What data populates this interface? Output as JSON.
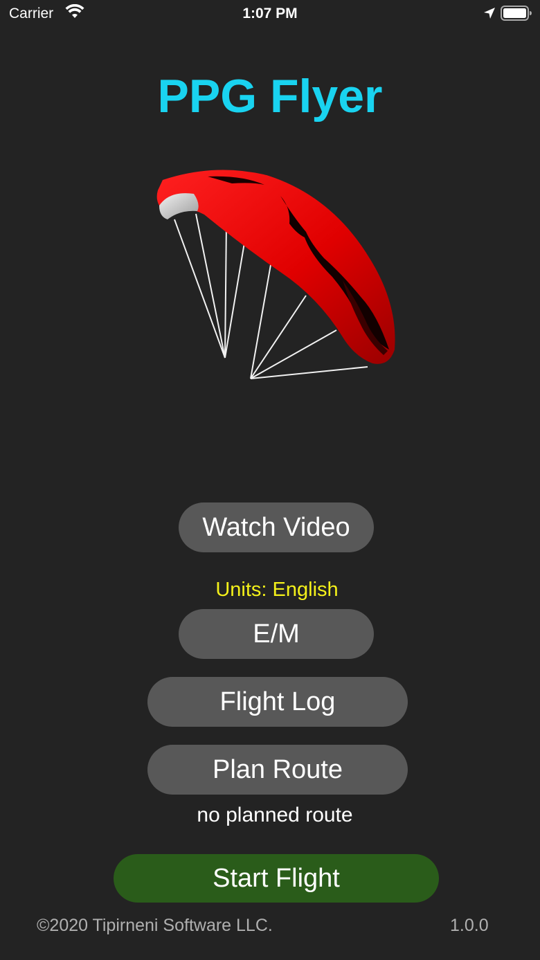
{
  "status_bar": {
    "carrier": "Carrier",
    "time": "1:07 PM",
    "icons": [
      "wifi-icon",
      "location-arrow-icon",
      "battery-icon"
    ]
  },
  "app": {
    "title": "PPG Flyer",
    "title_color": "#19d3f0",
    "logo_icon": "paraglider-wing-icon",
    "wing_color": "#e00000"
  },
  "buttons": {
    "watch_video": "Watch Video",
    "units_toggle": "E/M",
    "flight_log": "Flight Log",
    "plan_route": "Plan Route",
    "start_flight": "Start Flight"
  },
  "units": {
    "label": "Units: English",
    "label_color": "#f4f11a"
  },
  "route": {
    "status": "no planned route"
  },
  "footer": {
    "copyright": "©2020 Tipirneni Software LLC.",
    "version": "1.0.0"
  },
  "colors": {
    "background": "#232323",
    "button_gray": "#585858",
    "start_button_green": "#2a5c1a"
  }
}
